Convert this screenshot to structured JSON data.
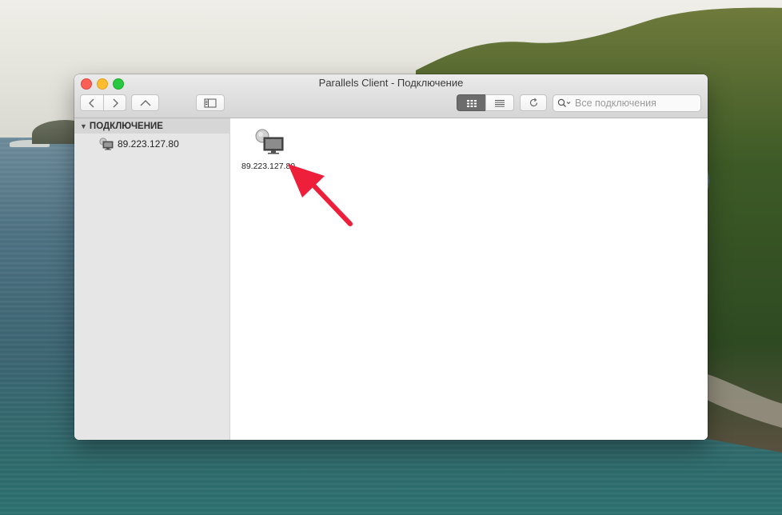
{
  "window": {
    "title": "Parallels Client - Подключение"
  },
  "toolbar": {
    "back_icon": "chevron-left-icon",
    "forward_icon": "chevron-right-icon",
    "up_icon": "chevron-up-icon",
    "sidebar_toggle_icon": "sidebar-icon",
    "grid_view_icon": "grid-view-icon",
    "list_view_icon": "list-view-icon",
    "refresh_icon": "refresh-icon",
    "search": {
      "placeholder": "Все подключения",
      "value": ""
    }
  },
  "sidebar": {
    "section_title": "ПОДКЛЮЧЕНИЕ",
    "items": [
      {
        "label": "89.223.127.80",
        "icon": "remote-desktop-icon"
      }
    ]
  },
  "main": {
    "connections": [
      {
        "label": "89.223.127.80",
        "icon": "remote-desktop-icon"
      }
    ]
  },
  "colors": {
    "close": "#fe5f57",
    "minimize": "#febc2e",
    "maximize": "#28c840",
    "annotation_arrow": "#ee1f3b"
  }
}
